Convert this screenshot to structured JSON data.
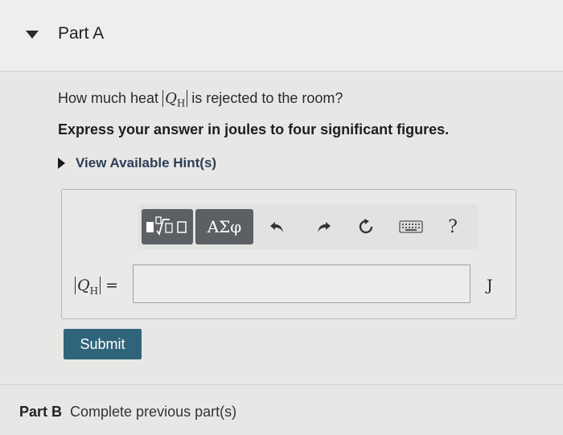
{
  "part_a": {
    "title": "Part A"
  },
  "question": {
    "prefix": "How much heat ",
    "symbol": "Q",
    "subscript": "H",
    "suffix": " is rejected to the room?"
  },
  "instruction": "Express your answer in joules to four significant figures.",
  "hints": {
    "label": "View Available Hint(s)"
  },
  "toolbar": {
    "greek_label": "ΑΣφ",
    "help_label": "?",
    "icons": [
      "templates-icon",
      "undo-icon",
      "redo-icon",
      "reset-icon",
      "keyboard-icon",
      "help-icon"
    ]
  },
  "answer": {
    "symbol": "Q",
    "subscript": "H",
    "equals": "=",
    "value": "",
    "unit": "J"
  },
  "submit": {
    "label": "Submit"
  },
  "part_b": {
    "title": "Part B",
    "status": "Complete previous part(s)"
  },
  "colors": {
    "submit_bg": "#2f647b",
    "hint_text": "#2d3e57",
    "toolbar_button": "#5c5f63"
  }
}
